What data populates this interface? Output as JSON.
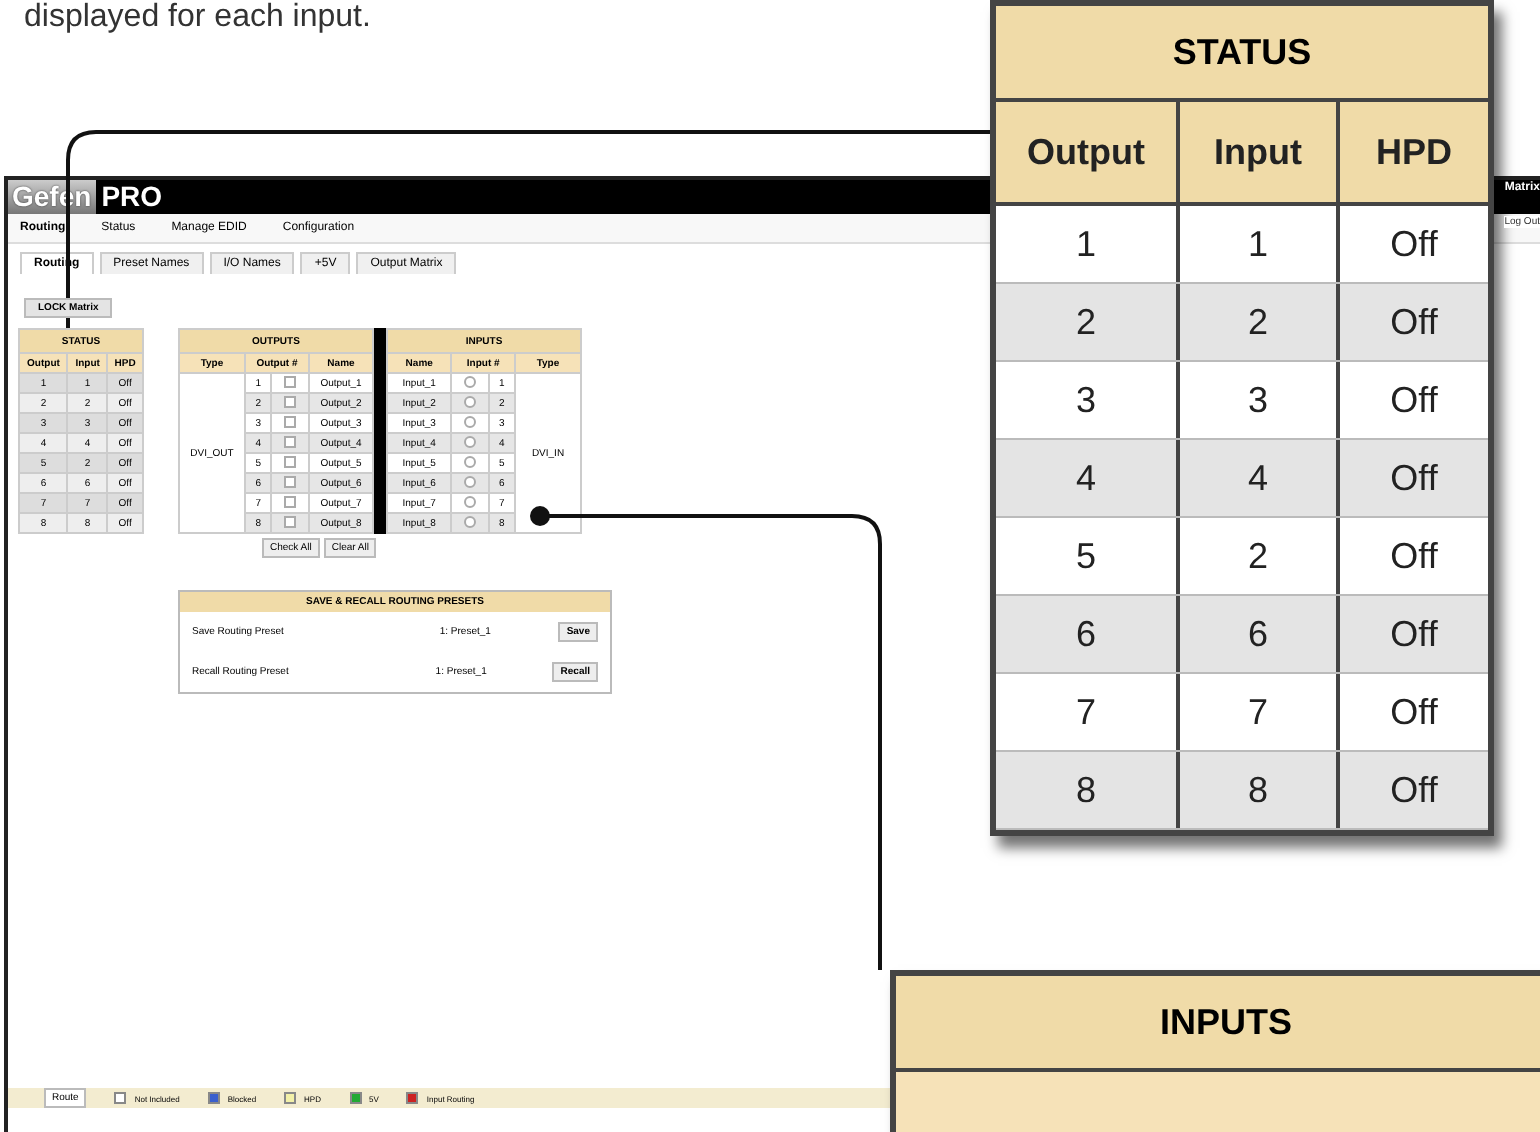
{
  "caption": "displayed for each input.",
  "app": {
    "logo": {
      "brand": "Gefen",
      "suffix": "PRO"
    },
    "title": "Matrix",
    "logout": "Log Out",
    "menu": [
      {
        "label": "Routing",
        "selected": true
      },
      {
        "label": "Status",
        "selected": false
      },
      {
        "label": "Manage EDID",
        "selected": false
      },
      {
        "label": "Configuration",
        "selected": false
      }
    ],
    "subtabs": [
      {
        "label": "Routing",
        "selected": true
      },
      {
        "label": "Preset Names",
        "selected": false
      },
      {
        "label": "I/O Names",
        "selected": false
      },
      {
        "label": "+5V",
        "selected": false
      },
      {
        "label": "Output Matrix",
        "selected": false
      }
    ],
    "lock_button": "LOCK Matrix",
    "status": {
      "title": "STATUS",
      "columns": [
        "Output",
        "Input",
        "HPD"
      ],
      "rows": [
        [
          "1",
          "1",
          "Off"
        ],
        [
          "2",
          "2",
          "Off"
        ],
        [
          "3",
          "3",
          "Off"
        ],
        [
          "4",
          "4",
          "Off"
        ],
        [
          "5",
          "2",
          "Off"
        ],
        [
          "6",
          "6",
          "Off"
        ],
        [
          "7",
          "7",
          "Off"
        ],
        [
          "8",
          "8",
          "Off"
        ]
      ]
    },
    "outputs": {
      "title": "OUTPUTS",
      "columns": [
        "Type",
        "Output #",
        "Name"
      ],
      "type": "DVI_OUT",
      "rows": [
        {
          "number": "1",
          "name": "Output_1",
          "checked": false
        },
        {
          "number": "2",
          "name": "Output_2",
          "checked": false
        },
        {
          "number": "3",
          "name": "Output_3",
          "checked": false
        },
        {
          "number": "4",
          "name": "Output_4",
          "checked": false
        },
        {
          "number": "5",
          "name": "Output_5",
          "checked": false
        },
        {
          "number": "6",
          "name": "Output_6",
          "checked": false
        },
        {
          "number": "7",
          "name": "Output_7",
          "checked": false
        },
        {
          "number": "8",
          "name": "Output_8",
          "checked": false
        }
      ]
    },
    "inputs": {
      "title": "INPUTS",
      "columns": [
        "Name",
        "Input #",
        "Type"
      ],
      "type": "DVI_IN",
      "rows": [
        {
          "name": "Input_1",
          "number": "1",
          "selected": false
        },
        {
          "name": "Input_2",
          "number": "2",
          "selected": false
        },
        {
          "name": "Input_3",
          "number": "3",
          "selected": false
        },
        {
          "name": "Input_4",
          "number": "4",
          "selected": false
        },
        {
          "name": "Input_5",
          "number": "5",
          "selected": false
        },
        {
          "name": "Input_6",
          "number": "6",
          "selected": false
        },
        {
          "name": "Input_7",
          "number": "7",
          "selected": false
        },
        {
          "name": "Input_8",
          "number": "8",
          "selected": false
        }
      ]
    },
    "check_all": "Check All",
    "clear_all": "Clear All",
    "presets": {
      "title": "SAVE & RECALL ROUTING PRESETS",
      "rows": [
        {
          "label": "Save Routing Preset",
          "value": "1: Preset_1",
          "button": "Save"
        },
        {
          "label": "Recall Routing Preset",
          "value": "1: Preset_1",
          "button": "Recall"
        }
      ]
    },
    "footer": {
      "route_button": "Route",
      "legend": [
        {
          "label": "Not Included",
          "color": "#ffffff"
        },
        {
          "label": "Blocked",
          "color": "#3a5fcd"
        },
        {
          "label": "HPD",
          "color": "#f2f0a8"
        },
        {
          "label": "5V",
          "color": "#22aa33"
        },
        {
          "label": "Input Routing",
          "color": "#cc2222"
        }
      ]
    }
  },
  "status_callout": {
    "title": "STATUS",
    "columns": [
      "Output",
      "Input",
      "HPD"
    ],
    "rows": [
      [
        "1",
        "1",
        "Off"
      ],
      [
        "2",
        "2",
        "Off"
      ],
      [
        "3",
        "3",
        "Off"
      ],
      [
        "4",
        "4",
        "Off"
      ],
      [
        "5",
        "2",
        "Off"
      ],
      [
        "6",
        "6",
        "Off"
      ],
      [
        "7",
        "7",
        "Off"
      ],
      [
        "8",
        "8",
        "Off"
      ]
    ]
  },
  "inputs_callout": {
    "title": "INPUTS"
  }
}
